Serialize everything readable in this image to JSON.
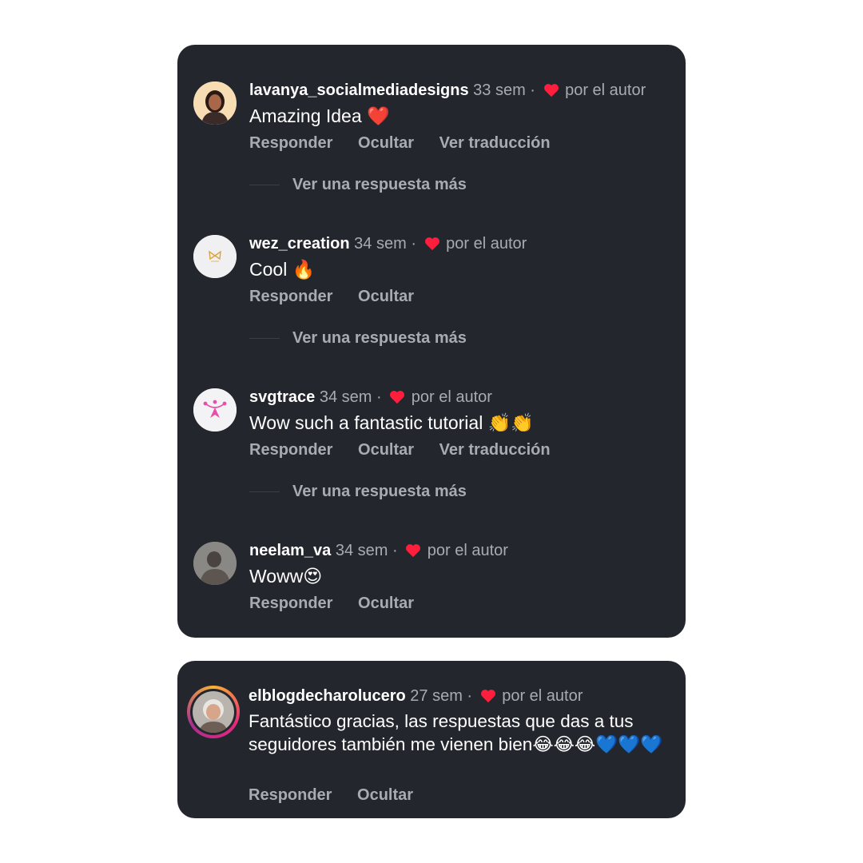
{
  "common": {
    "reply_label": "Responder",
    "hide_label": "Ocultar",
    "translate_label": "Ver traducción",
    "more_replies_label": "Ver una respuesta más",
    "liked_by_author": "por el autor",
    "heart_color": "#ff1f3d"
  },
  "comments": [
    {
      "username": "lavanya_socialmediadesigns",
      "time": "33 sem",
      "text": "Amazing Idea ❤️",
      "avatar_icon": "woman-portrait-avatar"
    },
    {
      "username": "wez_creation",
      "time": "34 sem",
      "text": "Cool 🔥",
      "avatar_icon": "butterfly-logo-avatar"
    },
    {
      "username": "svgtrace",
      "time": "34 sem",
      "text": "Wow such a fantastic tutorial 👏👏",
      "avatar_icon": "vector-pen-logo-avatar"
    },
    {
      "username": "neelam_va",
      "time": "34 sem",
      "text": "Woww😍",
      "avatar_icon": "person-photo-avatar"
    },
    {
      "username": "elblogdecharolucero",
      "time": "27 sem",
      "text": "Fantástico gracias, las respuestas que das a tus seguidores también me vienen bien😂😂😂💙💙💙",
      "avatar_icon": "woman-portrait-story-ring-avatar"
    }
  ]
}
